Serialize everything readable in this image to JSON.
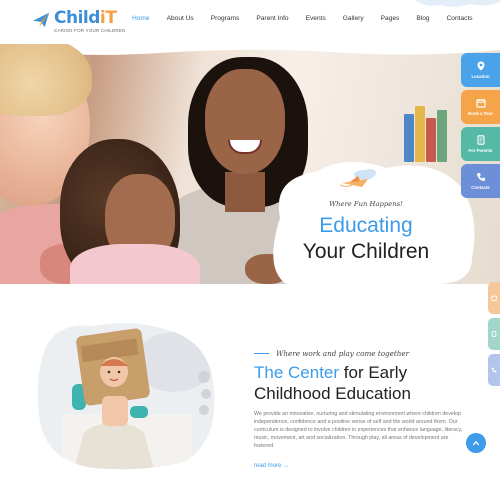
{
  "brand": {
    "name_main": "Child",
    "name_accent": "iT",
    "tagline": "CARING FOR YOUR CHILDREN",
    "colors": {
      "primary": "#3d9be9",
      "accent": "#f5a142",
      "dark": "#222222"
    }
  },
  "nav": {
    "items": [
      {
        "label": "Home",
        "active": true
      },
      {
        "label": "About Us"
      },
      {
        "label": "Programs"
      },
      {
        "label": "Parent Info"
      },
      {
        "label": "Events"
      },
      {
        "label": "Gallery"
      },
      {
        "label": "Pages"
      },
      {
        "label": "Blog"
      },
      {
        "label": "Contacts"
      }
    ]
  },
  "hero": {
    "tagline": "Where Fun Happens!",
    "title_line1": "Educating",
    "title_line2": "Your Children"
  },
  "side_buttons": [
    {
      "label": "Location",
      "icon": "location-pin-icon",
      "color": "#4aa3ea"
    },
    {
      "label": "Book a Tour",
      "icon": "calendar-icon",
      "color": "#f6a44a"
    },
    {
      "label": "For Parents",
      "icon": "document-icon",
      "color": "#55b9a6"
    },
    {
      "label": "Contacts",
      "icon": "phone-icon",
      "color": "#6d8fd8"
    }
  ],
  "side_mini_buttons": [
    {
      "icon": "calendar-icon",
      "color": "#f6c79a"
    },
    {
      "icon": "document-icon",
      "color": "#a3d6cb"
    },
    {
      "icon": "phone-icon",
      "color": "#b3c5ec"
    }
  ],
  "about": {
    "tagline": "Where work and play come together",
    "title_highlight": "The Center",
    "title_rest_line1": " for Early",
    "title_line2": "Childhood Education",
    "body": "We provide an innovative, nurturing and stimulating environment where children develop independence, confidence and a positive sense of self and the world around them. Our curriculum is designed to involve children in experiences that enhance language, literacy, music, movement, art and socialization. Through play, all areas of development are fostered.",
    "read_more": "read more  →"
  }
}
